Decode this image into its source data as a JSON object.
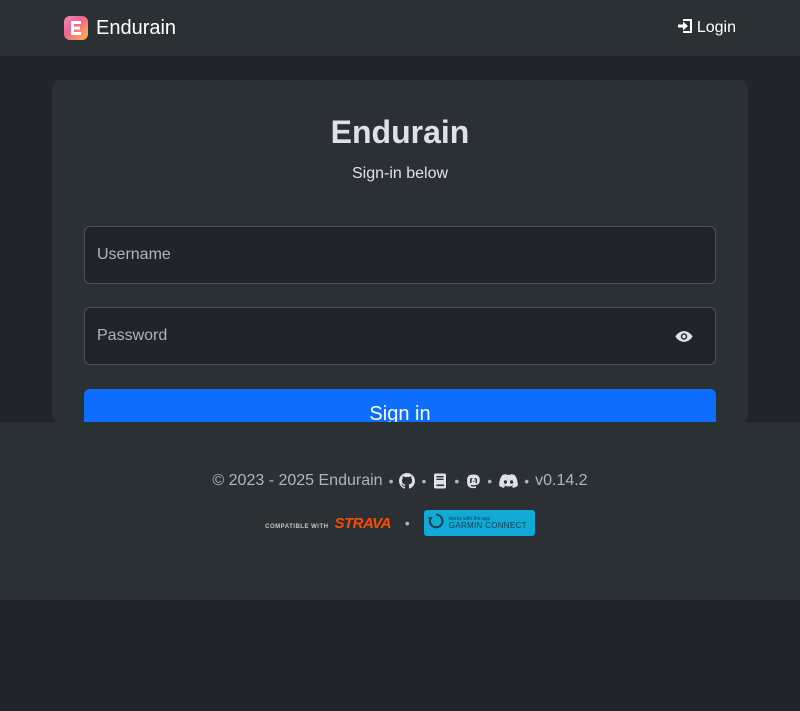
{
  "navbar": {
    "brand_letter": "E",
    "brand_name": "Endurain",
    "login_label": "Login"
  },
  "login": {
    "title": "Endurain",
    "subtitle": "Sign-in below",
    "username_placeholder": "Username",
    "password_placeholder": "Password",
    "submit_label": "Sign in"
  },
  "footer": {
    "copyright": "© 2023 - 2025 Endurain",
    "separator": "•",
    "version": "v0.14.2",
    "icons": [
      "github-icon",
      "book-icon",
      "mastodon-icon",
      "discord-icon"
    ],
    "strava_small": "COMPATIBLE WITH",
    "strava_big": "STRAVA",
    "garmin_small": "works with the app",
    "garmin_big": "GARMIN CONNECT"
  },
  "colors": {
    "page_bg": "#212529",
    "surface": "#2b3035",
    "primary": "#0d6efd",
    "strava": "#fc4c02",
    "garmin": "#11a9d6"
  }
}
